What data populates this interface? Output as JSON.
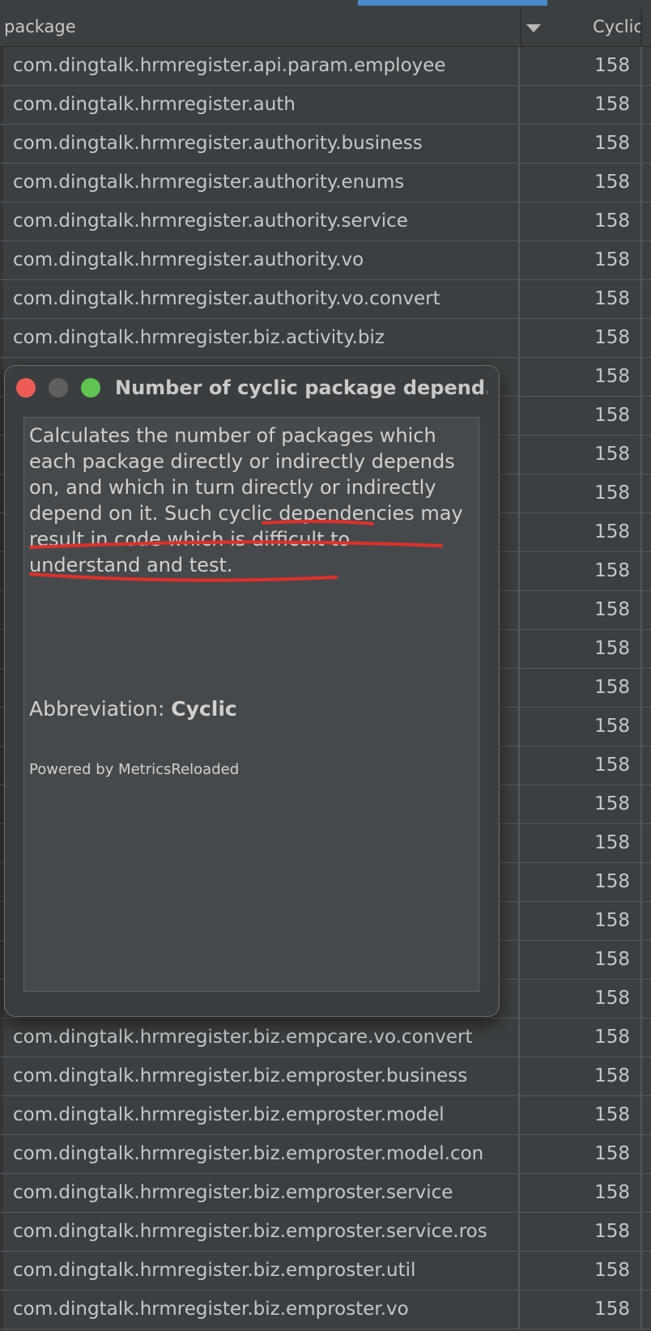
{
  "table": {
    "header": {
      "package_col": "package",
      "cyclic_col": "Cyclic",
      "sort_icon": "dropdown-arrow-icon"
    },
    "rows": [
      {
        "package": "com.dingtalk.hrmregister.api.param.employee",
        "cyclic": "158"
      },
      {
        "package": "com.dingtalk.hrmregister.auth",
        "cyclic": "158"
      },
      {
        "package": "com.dingtalk.hrmregister.authority.business",
        "cyclic": "158"
      },
      {
        "package": "com.dingtalk.hrmregister.authority.enums",
        "cyclic": "158"
      },
      {
        "package": "com.dingtalk.hrmregister.authority.service",
        "cyclic": "158"
      },
      {
        "package": "com.dingtalk.hrmregister.authority.vo",
        "cyclic": "158"
      },
      {
        "package": "com.dingtalk.hrmregister.authority.vo.convert",
        "cyclic": "158"
      },
      {
        "package": "com.dingtalk.hrmregister.biz.activity.biz",
        "cyclic": "158"
      },
      {
        "package": "",
        "cyclic": "158"
      },
      {
        "package": "",
        "cyclic": "158"
      },
      {
        "package": "",
        "cyclic": "158"
      },
      {
        "package": "",
        "cyclic": "158"
      },
      {
        "package": "",
        "cyclic": "158"
      },
      {
        "package": "",
        "cyclic": "158"
      },
      {
        "package": "",
        "cyclic": "158"
      },
      {
        "package": "",
        "cyclic": "158"
      },
      {
        "package": "",
        "cyclic": "158"
      },
      {
        "package": "",
        "cyclic": "158"
      },
      {
        "package": "",
        "cyclic": "158"
      },
      {
        "package": "",
        "cyclic": "158"
      },
      {
        "package": "",
        "cyclic": "158"
      },
      {
        "package": "",
        "cyclic": "158"
      },
      {
        "package": "",
        "cyclic": "158"
      },
      {
        "package": "",
        "cyclic": "158"
      },
      {
        "package": "",
        "cyclic": "158"
      },
      {
        "package": "com.dingtalk.hrmregister.biz.empcare.vo.convert",
        "cyclic": "158"
      },
      {
        "package": "com.dingtalk.hrmregister.biz.emproster.business",
        "cyclic": "158"
      },
      {
        "package": "com.dingtalk.hrmregister.biz.emproster.model",
        "cyclic": "158"
      },
      {
        "package": "com.dingtalk.hrmregister.biz.emproster.model.con",
        "cyclic": "158"
      },
      {
        "package": "com.dingtalk.hrmregister.biz.emproster.service",
        "cyclic": "158"
      },
      {
        "package": "com.dingtalk.hrmregister.biz.emproster.service.ros",
        "cyclic": "158"
      },
      {
        "package": "com.dingtalk.hrmregister.biz.emproster.util",
        "cyclic": "158"
      },
      {
        "package": "com.dingtalk.hrmregister.biz.emproster.vo",
        "cyclic": "158"
      }
    ]
  },
  "dialog": {
    "title": "Number of cyclic package depend...",
    "desc_part1": "Calculates the number of packages which each package directly or indirectly depends on, and which in turn directly or indirectly depend on it.",
    "desc_part2": "Such cyclic dependencies may result in code which is difficult to understand and test.",
    "abbreviation_label": "Abbreviation:",
    "abbreviation_value": "Cyclic",
    "powered_by": "Powered by MetricsReloaded",
    "annotation_color": "#e0302a"
  }
}
